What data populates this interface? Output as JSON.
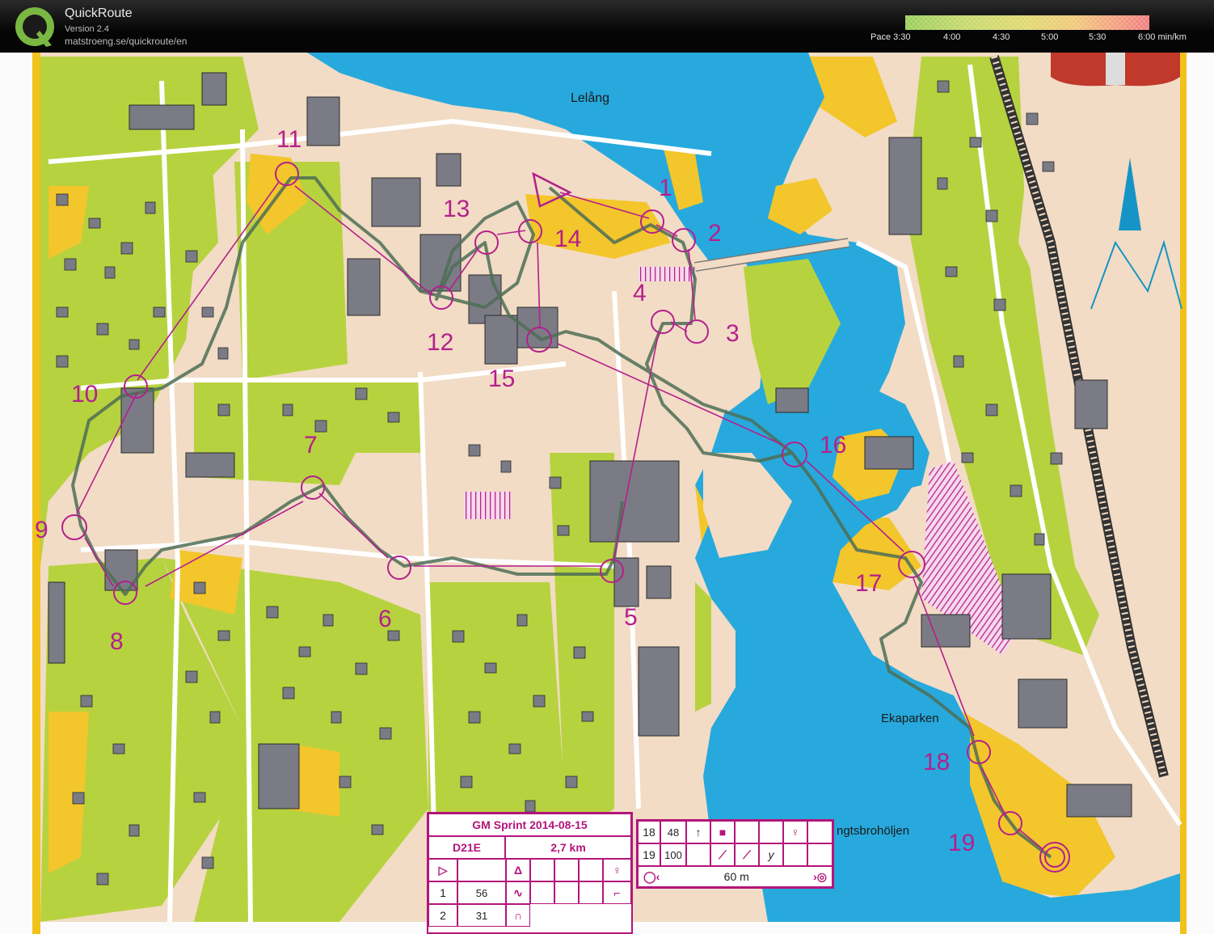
{
  "app": {
    "title": "QuickRoute",
    "version": "Version 2.4",
    "site": "matstroeng.se/quickroute/en"
  },
  "pace_legend": {
    "labels": [
      "Pace 3:30",
      "4:00",
      "4:30",
      "5:00",
      "5:30",
      "6:00  min/km"
    ],
    "colors": [
      "#9acd5a",
      "#c6d86a",
      "#e0d870",
      "#f0c77a",
      "#f2a27e",
      "#ef7d7d"
    ]
  },
  "map": {
    "colors": {
      "water": "#27a9dd",
      "open_yellow": "#f3c62b",
      "green": "#b7d23f",
      "paved": "#f2dcc5",
      "building": "#7b7b86",
      "course": "#b51f8c",
      "route": "#4e6e55"
    },
    "place_names": {
      "lake": "Lelång",
      "park": "Ekaparken",
      "cape": "ngtsbrohöljen"
    },
    "control_numbers": [
      "1",
      "2",
      "3",
      "4",
      "5",
      "6",
      "7",
      "8",
      "9",
      "10",
      "11",
      "12",
      "13",
      "14",
      "15",
      "16",
      "17",
      "18",
      "19"
    ]
  },
  "sheet_main": {
    "title": "GM Sprint 2014-08-15",
    "class": "D21E",
    "length": "2,7 km",
    "row1_num": "1",
    "row1_code": "56",
    "row2_num": "2",
    "row2_code": "31"
  },
  "sheet_right": {
    "row18_num": "18",
    "row18_code": "48",
    "row19_num": "19",
    "row19_code": "100",
    "y_symbol": "y",
    "finish_distance": "60 m"
  }
}
